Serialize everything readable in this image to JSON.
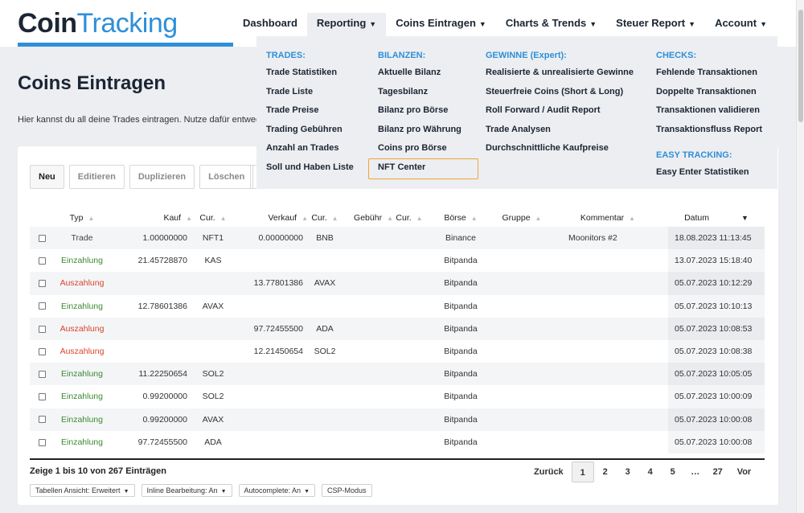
{
  "logo": {
    "part1": "Coin",
    "part2": "Tracking"
  },
  "nav": [
    {
      "label": "Dashboard",
      "caret": ""
    },
    {
      "label": "Reporting",
      "caret": "▼"
    },
    {
      "label": "Coins Eintragen",
      "caret": "▼"
    },
    {
      "label": "Charts & Trends",
      "caret": "▼"
    },
    {
      "label": "Steuer Report",
      "caret": "▼"
    },
    {
      "label": "Account",
      "caret": "▼"
    }
  ],
  "page": {
    "title": "Coins Eintragen",
    "intro": "Hier kannst du all deine Trades eintragen. Nutze dafür entweder die"
  },
  "toolbar": {
    "new": "Neu",
    "edit": "Editieren",
    "duplicate": "Duplizieren",
    "delete": "Löschen"
  },
  "table": {
    "headers": {
      "typ": "Typ",
      "kauf": "Kauf",
      "cur1": "Cur.",
      "verkauf": "Verkauf",
      "cur2": "Cur.",
      "gebuehr": "Gebühr",
      "cur3": "Cur.",
      "boerse": "Börse",
      "gruppe": "Gruppe",
      "kommentar": "Kommentar",
      "datum": "Datum"
    },
    "rows": [
      {
        "typ": "Trade",
        "kind": "trade",
        "kauf": "1.00000000",
        "kcur": "NFT1",
        "verkauf": "0.00000000",
        "vcur": "BNB",
        "boerse": "Binance",
        "kommentar": "Moonitors #2",
        "datum": "18.08.2023 11:13:45"
      },
      {
        "typ": "Einzahlung",
        "kind": "in",
        "kauf": "21.45728870",
        "kcur": "KAS",
        "verkauf": "",
        "vcur": "",
        "boerse": "Bitpanda",
        "kommentar": "",
        "datum": "13.07.2023 15:18:40"
      },
      {
        "typ": "Auszahlung",
        "kind": "out",
        "kauf": "",
        "kcur": "",
        "verkauf": "13.77801386",
        "vcur": "AVAX",
        "boerse": "Bitpanda",
        "kommentar": "",
        "datum": "05.07.2023 10:12:29"
      },
      {
        "typ": "Einzahlung",
        "kind": "in",
        "kauf": "12.78601386",
        "kcur": "AVAX",
        "verkauf": "",
        "vcur": "",
        "boerse": "Bitpanda",
        "kommentar": "",
        "datum": "05.07.2023 10:10:13"
      },
      {
        "typ": "Auszahlung",
        "kind": "out",
        "kauf": "",
        "kcur": "",
        "verkauf": "97.72455500",
        "vcur": "ADA",
        "boerse": "Bitpanda",
        "kommentar": "",
        "datum": "05.07.2023 10:08:53"
      },
      {
        "typ": "Auszahlung",
        "kind": "out",
        "kauf": "",
        "kcur": "",
        "verkauf": "12.21450654",
        "vcur": "SOL2",
        "boerse": "Bitpanda",
        "kommentar": "",
        "datum": "05.07.2023 10:08:38"
      },
      {
        "typ": "Einzahlung",
        "kind": "in",
        "kauf": "11.22250654",
        "kcur": "SOL2",
        "verkauf": "",
        "vcur": "",
        "boerse": "Bitpanda",
        "kommentar": "",
        "datum": "05.07.2023 10:05:05"
      },
      {
        "typ": "Einzahlung",
        "kind": "in",
        "kauf": "0.99200000",
        "kcur": "SOL2",
        "verkauf": "",
        "vcur": "",
        "boerse": "Bitpanda",
        "kommentar": "",
        "datum": "05.07.2023 10:00:09"
      },
      {
        "typ": "Einzahlung",
        "kind": "in",
        "kauf": "0.99200000",
        "kcur": "AVAX",
        "verkauf": "",
        "vcur": "",
        "boerse": "Bitpanda",
        "kommentar": "",
        "datum": "05.07.2023 10:00:08"
      },
      {
        "typ": "Einzahlung",
        "kind": "in",
        "kauf": "97.72455500",
        "kcur": "ADA",
        "verkauf": "",
        "vcur": "",
        "boerse": "Bitpanda",
        "kommentar": "",
        "datum": "05.07.2023 10:00:08"
      }
    ]
  },
  "footer": {
    "summary": "Zeige 1 bis 10 von 267 Einträgen",
    "pager": {
      "prev": "Zurück",
      "pages": [
        "1",
        "2",
        "3",
        "4",
        "5",
        "…",
        "27"
      ],
      "next": "Vor"
    },
    "options": [
      "Tabellen Ansicht: Erweitert",
      "Inline Bearbeitung: An",
      "Autocomplete: An",
      "CSP-Modus"
    ]
  },
  "mega": {
    "trades": {
      "head": "TRADES:",
      "items": [
        "Trade Statistiken",
        "Trade Liste",
        "Trade Preise",
        "Trading Gebühren",
        "Anzahl an Trades",
        "Soll und Haben Liste"
      ]
    },
    "bilanzen": {
      "head": "BILANZEN:",
      "items": [
        "Aktuelle Bilanz",
        "Tagesbilanz",
        "Bilanz pro Börse",
        "Bilanz pro Währung",
        "Coins pro Börse",
        "NFT Center"
      ]
    },
    "gewinne": {
      "head": "GEWINNE (Expert):",
      "items": [
        "Realisierte & unrealisierte Gewinne",
        "Steuerfreie Coins (Short & Long)",
        "Roll Forward / Audit Report",
        "Trade Analysen",
        "Durchschnittliche Kaufpreise"
      ]
    },
    "checks": {
      "head": "CHECKS:",
      "items": [
        "Fehlende Transaktionen",
        "Doppelte Transaktionen",
        "Transaktionen validieren",
        "Transaktionsfluss Report"
      ]
    },
    "easy": {
      "head": "EASY TRACKING:",
      "items": [
        "Easy Enter Statistiken"
      ]
    }
  },
  "colors": {
    "brand": "#2f8fd8",
    "deposit": "#3c8a32",
    "withdrawal": "#d8452b",
    "highlight": "#f0a43a"
  }
}
